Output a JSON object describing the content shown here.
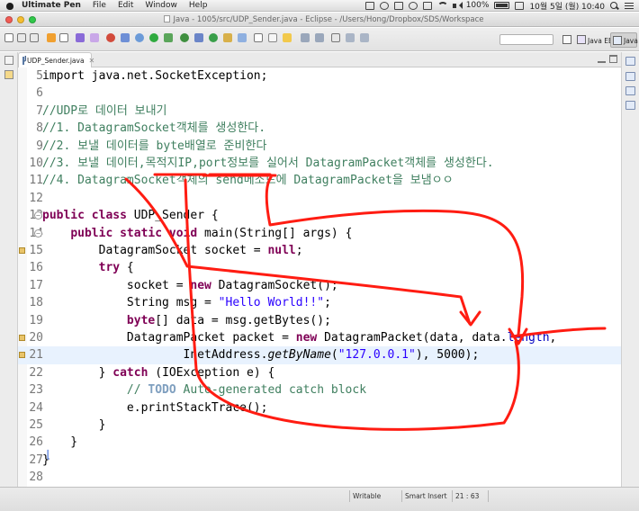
{
  "menubar": {
    "app_name": "Ultimate Pen",
    "items": [
      "File",
      "Edit",
      "Window",
      "Help"
    ],
    "battery": "100%",
    "date_time": "10월 5일 (월)  10:40"
  },
  "window": {
    "title": "Java - 1005/src/UDP_Sender.java - Eclipse - /Users/Hong/Dropbox/SDS/Workspace"
  },
  "toolbar": {
    "perspective_java_ee": "Java EE",
    "perspective_java": "Java"
  },
  "editor": {
    "tab_label": "UDP_Sender.java",
    "lines": [
      {
        "n": "5",
        "segs": [
          [
            "",
            "import java.net.SocketException;"
          ]
        ]
      },
      {
        "n": "6",
        "segs": [
          [
            "",
            ""
          ]
        ]
      },
      {
        "n": "7",
        "segs": [
          [
            "cm",
            "//UDP로 데이터 보내기"
          ]
        ]
      },
      {
        "n": "8",
        "segs": [
          [
            "cm",
            "//1. DatagramSocket객체를 생성한다."
          ]
        ]
      },
      {
        "n": "9",
        "segs": [
          [
            "cm",
            "//2. 보낼 데이터를 byte배열로 준비한다"
          ]
        ]
      },
      {
        "n": "10",
        "segs": [
          [
            "cm",
            "//3. 보낼 데이터,목적지IP,port정보를 실어서 DatagramPacket객체를 생성한다."
          ]
        ]
      },
      {
        "n": "11",
        "segs": [
          [
            "cm",
            "//4. DatagramSocket객체의 send메소드에 DatagramPacket을 보냄ㅇㅇ"
          ]
        ]
      },
      {
        "n": "12",
        "segs": [
          [
            "",
            ""
          ]
        ]
      },
      {
        "n": "13",
        "segs": [
          [
            "kw",
            "public class"
          ],
          [
            "",
            " UDP_Sender {"
          ]
        ]
      },
      {
        "n": "14",
        "segs": [
          [
            "",
            "    "
          ],
          [
            "kw",
            "public static void"
          ],
          [
            "",
            " main(String[] args) {"
          ]
        ]
      },
      {
        "n": "15",
        "segs": [
          [
            "",
            "        DatagramSocket socket = "
          ],
          [
            "kw",
            "null"
          ],
          [
            "",
            ";"
          ]
        ]
      },
      {
        "n": "16",
        "segs": [
          [
            "",
            "        "
          ],
          [
            "kw",
            "try"
          ],
          [
            "",
            " {"
          ]
        ]
      },
      {
        "n": "17",
        "segs": [
          [
            "",
            "            socket = "
          ],
          [
            "kw",
            "new"
          ],
          [
            "",
            " DatagramSocket();"
          ]
        ]
      },
      {
        "n": "18",
        "segs": [
          [
            "",
            "            String msg = "
          ],
          [
            "str",
            "\"Hello World!!\""
          ],
          [
            "",
            ";"
          ]
        ]
      },
      {
        "n": "19",
        "segs": [
          [
            "",
            "            "
          ],
          [
            "kw",
            "byte"
          ],
          [
            "",
            "[] data = msg.getBytes();"
          ]
        ]
      },
      {
        "n": "20",
        "segs": [
          [
            "",
            "            DatagramPacket packet = "
          ],
          [
            "kw",
            "new"
          ],
          [
            "",
            " DatagramPacket(data, data."
          ],
          [
            "fld",
            "length"
          ],
          [
            "",
            ","
          ]
        ]
      },
      {
        "n": "21",
        "segs": [
          [
            "",
            "                    InetAddress."
          ],
          [
            "itl",
            "getByName"
          ],
          [
            "",
            "("
          ],
          [
            "str",
            "\"127.0.0.1\""
          ],
          [
            "",
            "), 5000);"
          ]
        ]
      },
      {
        "n": "22",
        "segs": [
          [
            "",
            "        } "
          ],
          [
            "kw",
            "catch"
          ],
          [
            "",
            " (IOException e) {"
          ]
        ]
      },
      {
        "n": "23",
        "segs": [
          [
            "",
            "            "
          ],
          [
            "cm",
            "// "
          ],
          [
            "todo",
            "TODO"
          ],
          [
            "cm",
            " Auto-generated catch block"
          ]
        ]
      },
      {
        "n": "24",
        "segs": [
          [
            "",
            "            e.printStackTrace();"
          ]
        ]
      },
      {
        "n": "25",
        "segs": [
          [
            "",
            "        }"
          ]
        ]
      },
      {
        "n": "26",
        "segs": [
          [
            "",
            "    }"
          ]
        ]
      },
      {
        "n": "27",
        "segs": [
          [
            "",
            "}"
          ]
        ]
      },
      {
        "n": "28",
        "segs": [
          [
            "",
            ""
          ]
        ]
      }
    ],
    "current_line": "21"
  },
  "status": {
    "mode": "Writable",
    "insert": "Smart Insert",
    "position": "21 : 63"
  }
}
